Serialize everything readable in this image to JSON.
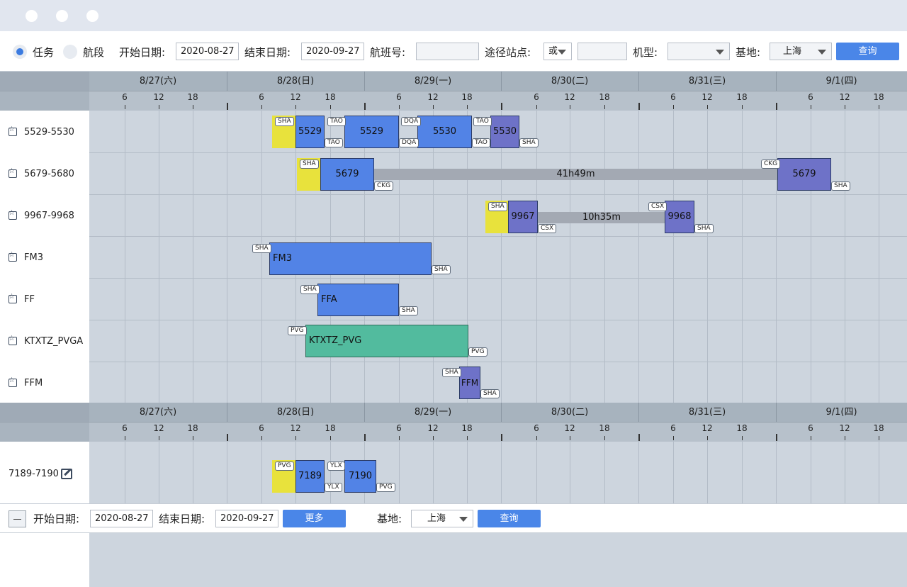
{
  "toolbar": {
    "radio_task": "任务",
    "radio_leg": "航段",
    "start_label": "开始日期:",
    "start_value": "2020-08-27",
    "end_label": "结束日期:",
    "end_value": "2020-09-27",
    "flight_label": "航班号:",
    "flight_value": "",
    "via_label": "途径站点:",
    "via_op": "或",
    "via_value": "",
    "aircraft_label": "机型:",
    "aircraft_value": "",
    "base_label": "基地:",
    "base_value": "上海",
    "query_label": "查询"
  },
  "timeline": {
    "days": [
      "8/27(六)",
      "8/28(日)",
      "8/29(一)",
      "8/30(二)",
      "8/31(三)",
      "9/1(四)"
    ],
    "hours": [
      "6",
      "12",
      "18"
    ]
  },
  "rows": [
    {
      "label": "5529-5530"
    },
    {
      "label": "5679-5680"
    },
    {
      "label": "9967-9968"
    },
    {
      "label": "FM3"
    },
    {
      "label": "FF"
    },
    {
      "label": "KTXTZ_PVGA"
    },
    {
      "label": "FFM"
    }
  ],
  "bars": {
    "r0_b1": "5529",
    "r0_b2": "5529",
    "r0_b3": "5530",
    "r0_b4": "5530",
    "r1_b1": "5679",
    "r1_gap": "41h49m",
    "r1_b2": "5679",
    "r2_b1": "9967",
    "r2_gap": "10h35m",
    "r2_b2": "9968",
    "r3_b1": "FM3",
    "r4_b1": "FFA",
    "r5_b1": "KTXTZ_PVG",
    "r6_b1": "FFM",
    "s2_b1": "7189",
    "s2_b2": "7190"
  },
  "tags": {
    "sha": "SHA",
    "tao": "TAO",
    "dqa": "DQA",
    "ckg": "CKG",
    "csx": "CSX",
    "pvg": "PVG",
    "ylx": "YLX"
  },
  "section2": {
    "row_label": "7189-7190"
  },
  "bottombar": {
    "start_label": "开始日期:",
    "start_value": "2020-08-27",
    "end_label": "结束日期:",
    "end_value": "2020-09-27",
    "more_label": "更多",
    "base_label": "基地:",
    "base_value": "上海",
    "query_label": "查询"
  }
}
